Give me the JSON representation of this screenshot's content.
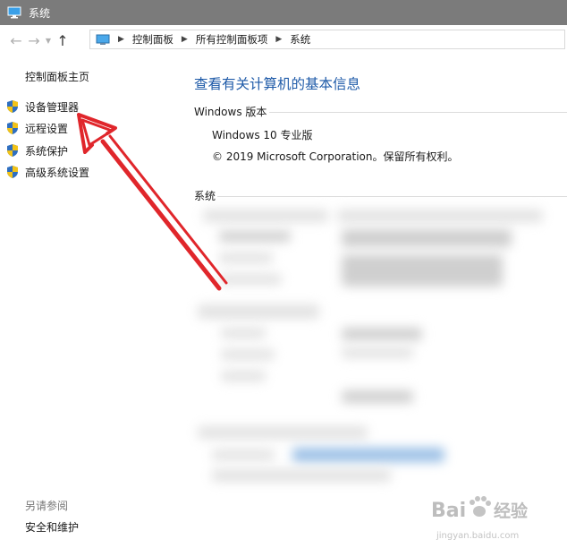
{
  "window": {
    "title": "系统",
    "icon": "system-window-icon"
  },
  "nav": {
    "back_icon": "back-arrow-icon",
    "forward_icon": "forward-arrow-icon",
    "recent_icon": "chevron-down-icon",
    "up_icon": "up-arrow-icon",
    "breadcrumb": [
      "控制面板",
      "所有控制面板项",
      "系统"
    ]
  },
  "sidebar": {
    "home": "控制面板主页",
    "items": [
      {
        "label": "设备管理器",
        "icon": "uac-shield-icon"
      },
      {
        "label": "远程设置",
        "icon": "uac-shield-icon"
      },
      {
        "label": "系统保护",
        "icon": "uac-shield-icon"
      },
      {
        "label": "高级系统设置",
        "icon": "uac-shield-icon"
      }
    ],
    "see_also": "另请参阅",
    "see_also_links": [
      "安全和维护"
    ]
  },
  "main": {
    "title": "查看有关计算机的基本信息",
    "windows_edition": {
      "heading": "Windows 版本",
      "lines": [
        "Windows 10 专业版",
        "© 2019 Microsoft Corporation。保留所有权利。"
      ]
    },
    "system": {
      "heading": "系统"
    }
  },
  "annotation": {
    "color": "#e0262b"
  },
  "watermark": {
    "text": "Bai",
    "text2": "经验",
    "subtext": "jingyan.baidu.com"
  },
  "colors": {
    "title_bar": "#7b7b7b",
    "link_blue": "#1e5aa8"
  }
}
